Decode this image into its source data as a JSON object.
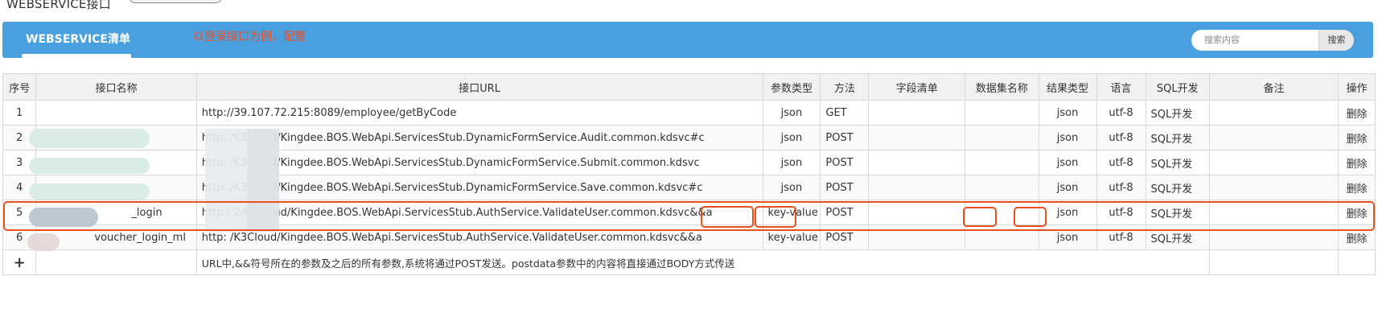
{
  "page": {
    "title": "WEBSERVICE接口"
  },
  "header": {
    "tab_label": "WEBSERVICE清单",
    "annotation": "以登录接口为例，配置",
    "search_placeholder": "搜索内容",
    "search_button": "搜索",
    "colors": {
      "bar": "#4a9fde",
      "annotation": "#e8522a",
      "highlight": "#e8501e"
    }
  },
  "table": {
    "columns": [
      "序号",
      "接口名称",
      "接口URL",
      "参数类型",
      "方法",
      "字段清单",
      "数据集名称",
      "结果类型",
      "语言",
      "SQL开发",
      "备注",
      "操作"
    ],
    "rows": [
      {
        "no": "1",
        "name": "",
        "url": "http://39.107.72.215:8089/employee/getByCode",
        "param": "json",
        "method": "GET",
        "fields": "",
        "dataset": "",
        "result": "json",
        "lang": "utf-8",
        "sql": "SQL开发",
        "remark": "",
        "op": "删除"
      },
      {
        "no": "2",
        "name": "",
        "url": "http:                    /K3Cloud/Kingdee.BOS.WebApi.ServicesStub.DynamicFormService.Audit.common.kdsvc#c",
        "param": "json",
        "method": "POST",
        "fields": "",
        "dataset": "",
        "result": "json",
        "lang": "utf-8",
        "sql": "SQL开发",
        "remark": "",
        "op": "删除"
      },
      {
        "no": "3",
        "name": "",
        "url": "http:                    /K3Cloud/Kingdee.BOS.WebApi.ServicesStub.DynamicFormService.Submit.common.kdsvc",
        "param": "json",
        "method": "POST",
        "fields": "",
        "dataset": "",
        "result": "json",
        "lang": "utf-8",
        "sql": "SQL开发",
        "remark": "",
        "op": "删除"
      },
      {
        "no": "4",
        "name": "",
        "url": "http:                    /K3Cloud/Kingdee.BOS.WebApi.ServicesStub.DynamicFormService.Save.common.kdsvc#c",
        "param": "json",
        "method": "POST",
        "fields": "",
        "dataset": "",
        "result": "json",
        "lang": "utf-8",
        "sql": "SQL开发",
        "remark": "",
        "op": "删除"
      },
      {
        "no": "5",
        "name": "_login",
        "url": "http:/                  2/K3Cloud/Kingdee.BOS.WebApi.ServicesStub.AuthService.ValidateUser.common.kdsvc&&a",
        "param": "key-value",
        "method": "POST",
        "fields": "",
        "dataset": "",
        "result": "json",
        "lang": "utf-8",
        "sql": "SQL开发",
        "remark": "",
        "op": "删除"
      },
      {
        "no": "6",
        "name": "voucher_login_ml",
        "url": "http:                    /K3Cloud/Kingdee.BOS.WebApi.ServicesStub.AuthService.ValidateUser.common.kdsvc&&a",
        "param": "key-value",
        "method": "POST",
        "fields": "",
        "dataset": "",
        "result": "json",
        "lang": "utf-8",
        "sql": "SQL开发",
        "remark": "",
        "op": "删除"
      }
    ],
    "add_symbol": "+",
    "footer_note": "URL中,&&符号所在的参数及之后的所有参数,系统将通过POST发送。postdata参数中的内容将直接通过BODY方式传送"
  }
}
